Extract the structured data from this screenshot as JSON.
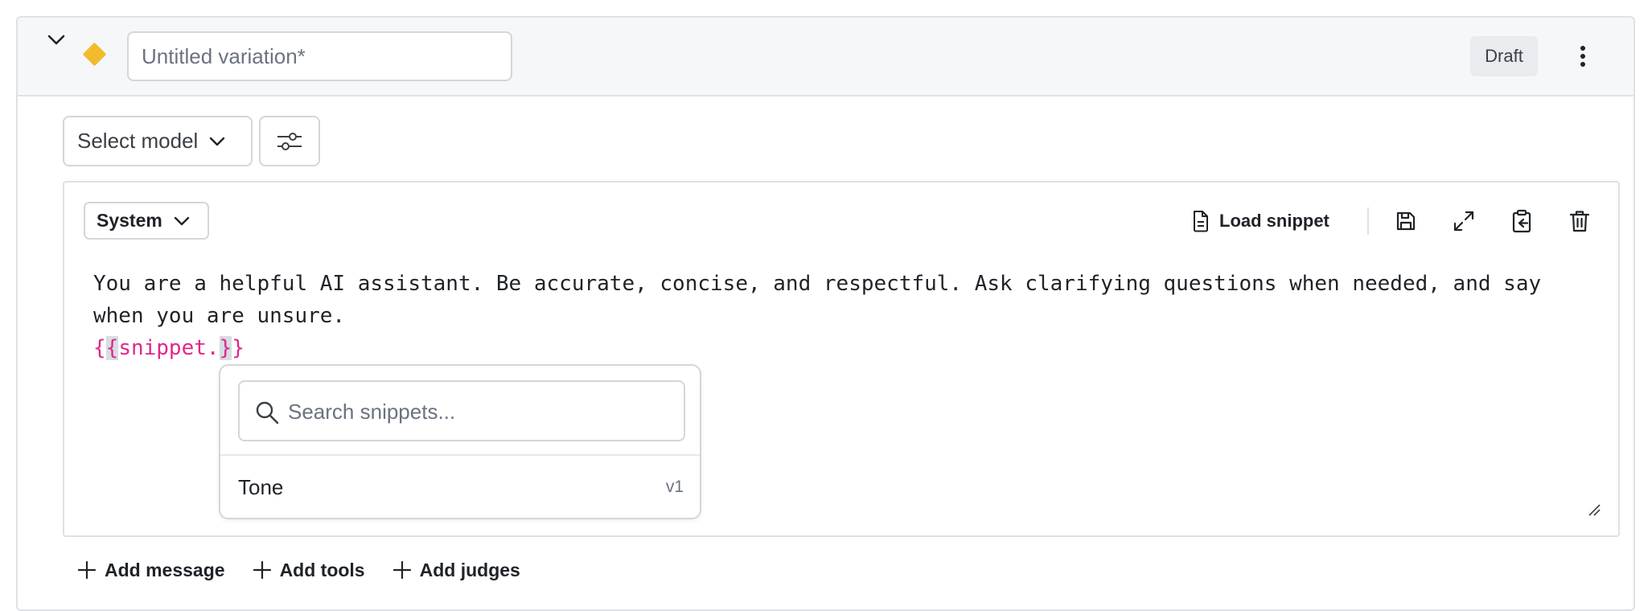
{
  "variation": {
    "name_value": "",
    "name_placeholder": "Untitled variation*",
    "status": "Draft",
    "accent_color": "#f1bc2c"
  },
  "model": {
    "select_label": "Select model"
  },
  "message": {
    "role": "System",
    "load_snippet_label": "Load snippet",
    "prompt_text": "You are a helpful AI assistant. Be accurate, concise, and respectful. Ask clarifying questions when needed, and say when you are unsure.",
    "token_open": "{",
    "token_open_hl": "{",
    "token_body": "snippet.",
    "token_close_hl": "}",
    "token_close": "}",
    "token_color": "#e0278a"
  },
  "snippet_popover": {
    "search_placeholder": "Search snippets...",
    "items": [
      {
        "name": "Tone",
        "version": "v1"
      }
    ]
  },
  "footer_actions": {
    "add_message": "Add message",
    "add_tools": "Add tools",
    "add_judges": "Add judges"
  },
  "icons": {
    "toggle": "chevron-down-icon",
    "status": "diamond-icon",
    "menu": "kebab-icon",
    "settings": "sliders-icon",
    "load": "file-icon",
    "save": "save-icon",
    "expand": "expand-icon",
    "paste": "clipboard-icon",
    "delete": "trash-icon",
    "search": "search-icon",
    "add": "plus-icon"
  }
}
